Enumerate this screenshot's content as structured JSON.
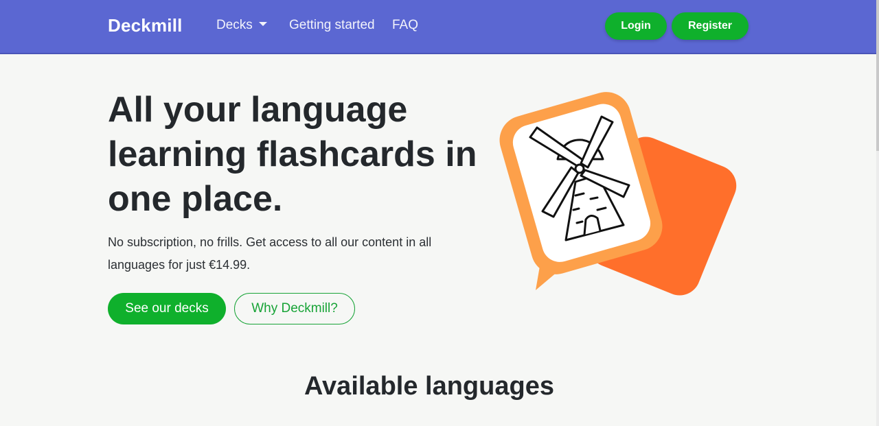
{
  "navbar": {
    "brand": "Deckmill",
    "links": {
      "decks": "Decks",
      "getting_started": "Getting started",
      "faq": "FAQ"
    },
    "login_label": "Login",
    "register_label": "Register",
    "colors": {
      "background": "#5b67d2",
      "button": "#0fb02c"
    }
  },
  "hero": {
    "title": "All your language learning flashcards in one place.",
    "subtitle": "No subscription, no frills. Get access to all our content in all languages for just €14.99.",
    "primary_button": "See our decks",
    "secondary_button": "Why Deckmill?",
    "illustration_icon": "windmill-icon",
    "colors": {
      "card_front": "#fda04a",
      "card_back": "#ff6f2b",
      "accent": "#17a336"
    }
  },
  "section": {
    "title": "Available languages"
  }
}
